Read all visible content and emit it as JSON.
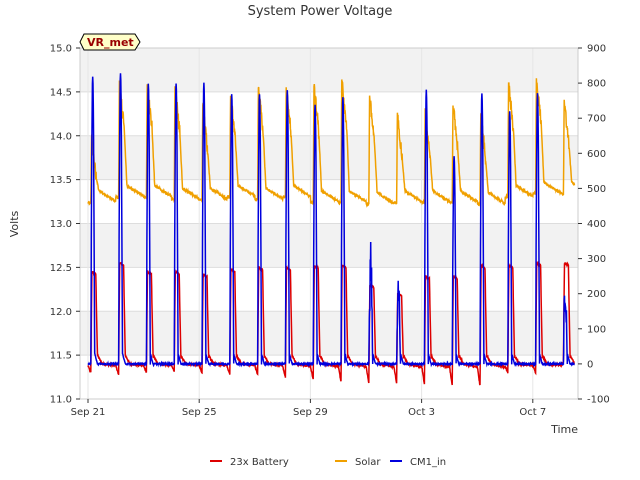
{
  "chart_data": {
    "type": "line",
    "title": "System Power Voltage",
    "xlabel": "Time",
    "ylabel": "Volts",
    "x_ticks": [
      {
        "label": "Sep 21",
        "day": 0
      },
      {
        "label": "Sep 25",
        "day": 4
      },
      {
        "label": "Sep 29",
        "day": 8
      },
      {
        "label": "Oct 3",
        "day": 12
      },
      {
        "label": "Oct 7",
        "day": 16
      }
    ],
    "xlim": [
      0,
      17.8
    ],
    "ylim": [
      11.0,
      15.0
    ],
    "y_ticks": [
      "11.0",
      "11.5",
      "12.0",
      "12.5",
      "13.0",
      "13.5",
      "14.0",
      "14.5",
      "15.0"
    ],
    "y2lim": [
      -100,
      900
    ],
    "y2_ticks": [
      "-100",
      "0",
      "100",
      "200",
      "300",
      "400",
      "500",
      "600",
      "700",
      "800",
      "900"
    ],
    "grid": true,
    "legend_position": "bottom-center",
    "annotation": "VR_met",
    "series": [
      {
        "name": "23x Battery",
        "axis": "left",
        "color": "#dd0000",
        "days": 17.5,
        "peaks": [
          12.45,
          12.55,
          12.45,
          12.45,
          12.42,
          12.48,
          12.5,
          12.5,
          12.52,
          12.52,
          12.3,
          12.2,
          12.4,
          12.4,
          12.52,
          12.52,
          12.55,
          12.55
        ],
        "troughs": [
          11.3,
          11.28,
          11.3,
          11.32,
          11.3,
          11.28,
          11.28,
          11.25,
          11.22,
          11.2,
          11.18,
          11.18,
          11.17,
          11.15,
          11.15,
          11.3,
          11.3,
          11.42
        ]
      },
      {
        "name": "Solar",
        "axis": "left",
        "color": "#f0a000",
        "days": 17.5,
        "peaks": [
          14.0,
          14.6,
          14.6,
          14.55,
          14.35,
          14.45,
          14.55,
          14.55,
          14.55,
          14.65,
          14.45,
          14.25,
          14.3,
          14.35,
          14.25,
          14.6,
          14.65,
          14.4
        ],
        "baselines": [
          13.22,
          13.28,
          13.28,
          13.25,
          13.25,
          13.28,
          13.25,
          13.28,
          13.22,
          13.22,
          13.2,
          13.22,
          13.22,
          13.22,
          13.2,
          13.28,
          13.32,
          13.32
        ]
      },
      {
        "name": "CM1_in",
        "axis": "right",
        "color": "#0000dd",
        "days": 17.5,
        "peaks": [
          820,
          830,
          800,
          800,
          800,
          770,
          770,
          780,
          740,
          760,
          320,
          220,
          780,
          590,
          770,
          720,
          770,
          250
        ],
        "baseline": 0
      }
    ]
  }
}
